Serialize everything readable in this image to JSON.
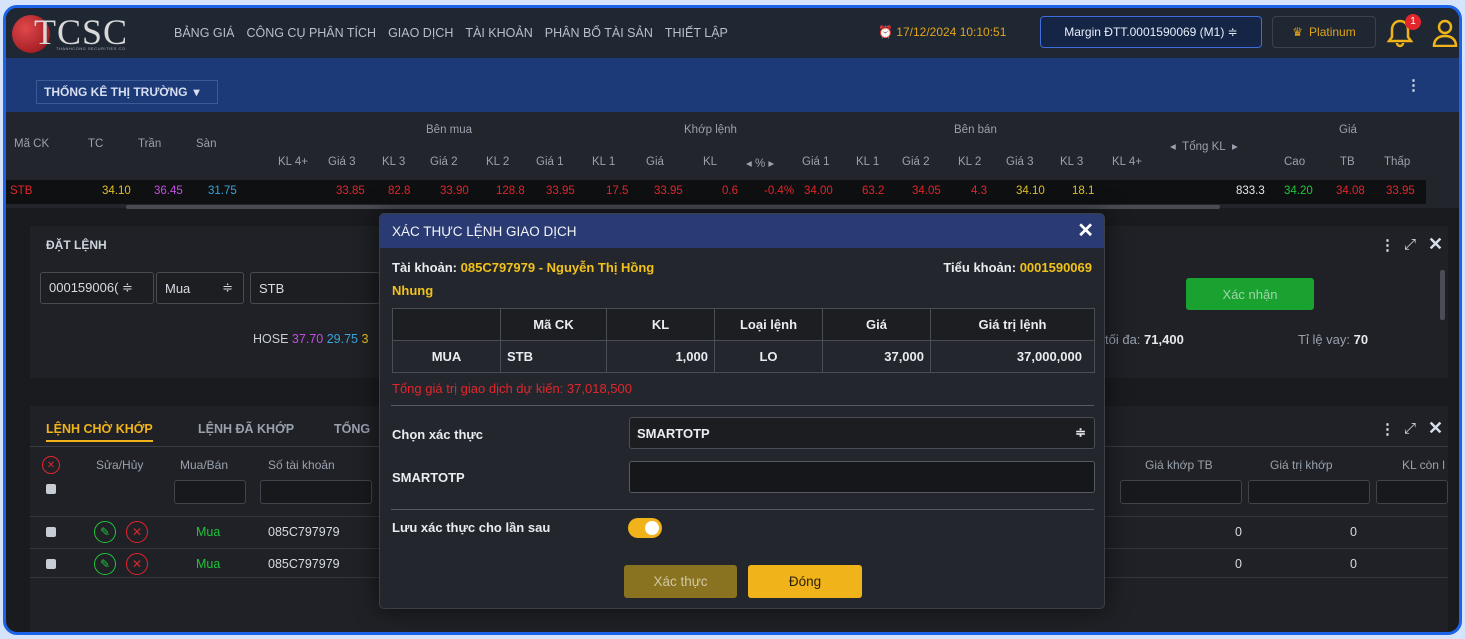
{
  "nav": {
    "logo": "TCSC",
    "logo_sub": "THANHCONG SECURITIES CO.",
    "menu": [
      "BẢNG GIÁ",
      "CÔNG CỤ PHÂN TÍCH",
      "GIAO DỊCH",
      "TÀI KHOẢN",
      "PHÂN BỔ TÀI SẢN",
      "THIẾT LẬP"
    ],
    "datetime": "17/12/2024 10:10:51",
    "account_select": "Margin ĐTT.0001590069 (M1) ≑",
    "tier": "Platinum",
    "notification_count": "1"
  },
  "market": {
    "stats_button": "THỐNG KÊ THỊ TRƯỜNG",
    "headers": {
      "symbol": "Mã CK",
      "ref": "TC",
      "ceil": "Trần",
      "floor": "Sàn",
      "buy_group": "Bên mua",
      "match_group": "Khớp lệnh",
      "sell_group": "Bên bán",
      "price_group": "Giá",
      "kl4p": "KL 4+",
      "g3": "Giá 3",
      "kl3": "KL 3",
      "g2": "Giá 2",
      "kl2": "KL 2",
      "g1": "Giá 1",
      "kl1": "KL 1",
      "mprice": "Giá",
      "mkl": "KL",
      "pct": "%",
      "total": "Tổng KL",
      "high": "Cao",
      "avg": "TB",
      "low": "Thấp"
    },
    "row": {
      "symbol": "STB",
      "ref": "34.10",
      "ceil": "36.45",
      "floor": "31.75",
      "b3": "33.85",
      "bk3": "82.8",
      "b2": "33.90",
      "bk2": "128.8",
      "b1": "33.95",
      "bk1": "17.5",
      "mp": "33.95",
      "mk": "0.6",
      "pct": "-0.4%",
      "s1": "34.00",
      "sk1": "63.2",
      "s2": "34.05",
      "sk2": "4.3",
      "s3": "34.10",
      "sk3": "18.1",
      "total": "833.3",
      "high": "34.20",
      "avg": "34.08",
      "low": "33.95"
    }
  },
  "order_panel": {
    "title": "ĐẶT LỆNH",
    "account": "000159006( ≑",
    "side": "Mua",
    "symbol": "STB",
    "exchange": "HOSE",
    "ceil": "37.70",
    "floor": "29.75",
    "ref_partial": "3",
    "confirm_button": "Xác nhận",
    "max_label": "tối đa:",
    "max_value": "71,400",
    "loan_label": "Tỉ lệ vay:",
    "loan_value": "70"
  },
  "orders": {
    "tabs": [
      "LỆNH CHỜ KHỚP",
      "LỆNH ĐÃ KHỚP",
      "TỔNG"
    ],
    "columns": [
      "Sửa/Hủy",
      "Mua/Bán",
      "Số tài khoản",
      "Giá khớp TB",
      "Giá trị khớp",
      "KL còn l"
    ],
    "rows": [
      {
        "side": "Mua",
        "account": "085C797979",
        "avg_match": "0",
        "match_value": "0"
      },
      {
        "side": "Mua",
        "account": "085C797979",
        "avg_match": "0",
        "match_value": "0"
      }
    ]
  },
  "modal": {
    "title": "XÁC THỰC LỆNH GIAO DỊCH",
    "account_label": "Tài khoản:",
    "account_value": "085C797979 - Nguyễn Thị Hồng",
    "account_value_2": "Nhung",
    "subaccount_label": "Tiểu khoản:",
    "subaccount_value": "0001590069",
    "columns": [
      "Mã CK",
      "KL",
      "Loại lệnh",
      "Giá",
      "Giá trị lệnh"
    ],
    "side": "MUA",
    "order": {
      "symbol": "STB",
      "qty": "1,000",
      "type": "LO",
      "price": "37,000",
      "value": "37,000,000"
    },
    "estimate": "Tổng giá trị giao dịch dự kiến: 37,018,500",
    "auth_label": "Chọn xác thực",
    "auth_value": "SMARTOTP",
    "otp_label": "SMARTOTP",
    "remember_label": "Lưu xác thực cho lần sau",
    "verify_button": "Xác thực",
    "close_button": "Đóng"
  }
}
